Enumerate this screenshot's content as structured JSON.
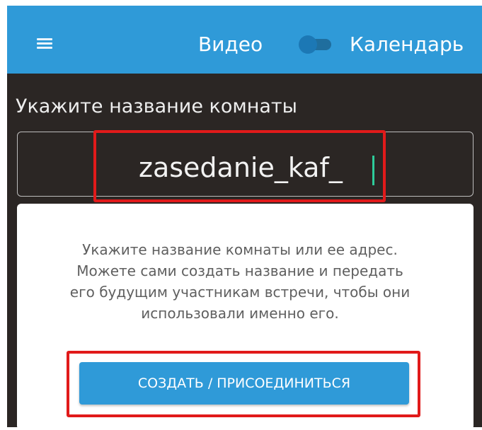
{
  "topbar": {
    "video_label": "Видео",
    "calendar_label": "Календарь",
    "video_toggle_on": false
  },
  "room": {
    "title": "Укажите название комнаты",
    "input_value": "zasedanie_kaf_"
  },
  "hint": {
    "lines": [
      "Укажите название комнаты или ее адрес.",
      "Можете сами создать название и передать",
      "его будущим участникам встречи, чтобы они",
      "использовали именно его."
    ]
  },
  "actions": {
    "join_label": "СОЗДАТЬ / ПРИСОЕДИНИТЬСЯ"
  },
  "colors": {
    "accent": "#2f9ad8",
    "background": "#2b2624",
    "highlight": "#e11a1a",
    "caret": "#2ecc9a"
  }
}
